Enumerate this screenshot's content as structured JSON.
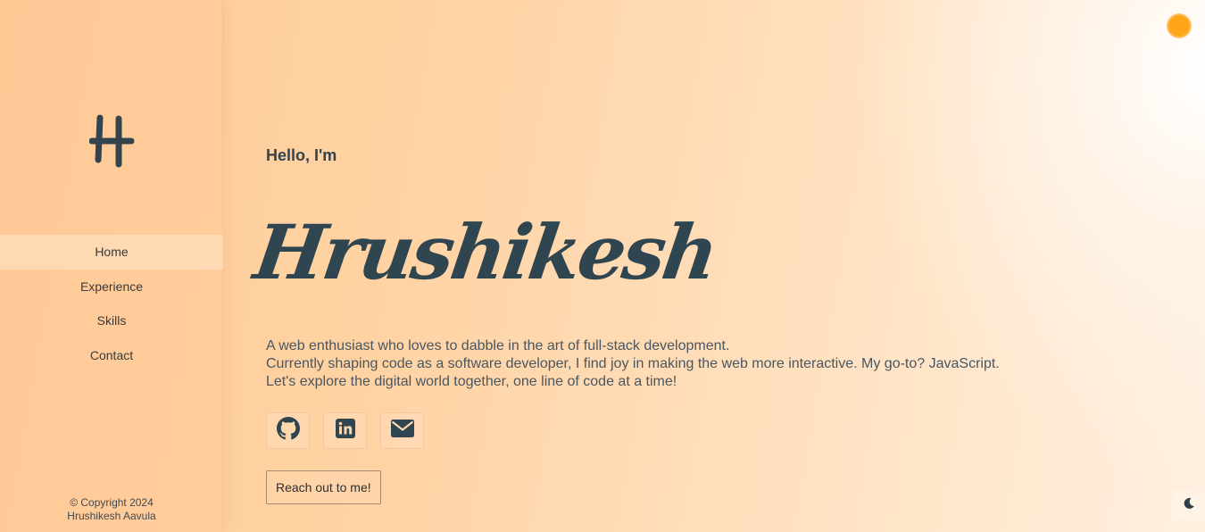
{
  "sidebar": {
    "logo_icon": "h-monogram-icon",
    "nav": [
      {
        "label": "Home",
        "active": true
      },
      {
        "label": "Experience",
        "active": false
      },
      {
        "label": "Skills",
        "active": false
      },
      {
        "label": "Contact",
        "active": false
      }
    ],
    "copyright_line1": "© Copyright 2024",
    "copyright_line2": "Hrushikesh Aavula"
  },
  "hero": {
    "greeting": "Hello, I'm",
    "name": "Hrushikesh",
    "bio": [
      "A web enthusiast who loves to dabble in the art of full-stack development.",
      "Currently shaping code as a software developer, I find joy in making the web more interactive. My go-to? JavaScript.",
      "Let's explore the digital world together, one line of code at a time!"
    ],
    "socials": [
      {
        "icon": "github-icon"
      },
      {
        "icon": "linkedin-icon"
      },
      {
        "icon": "email-icon"
      }
    ],
    "cta_label": "Reach out to me!"
  },
  "controls": {
    "sun_toggle_icon": "sun-dot-icon",
    "theme_toggle_icon": "moon-icon"
  },
  "colors": {
    "accent": "#ffa51a",
    "text_dark": "#2f4550",
    "bg_peach": "#ffcc96"
  }
}
